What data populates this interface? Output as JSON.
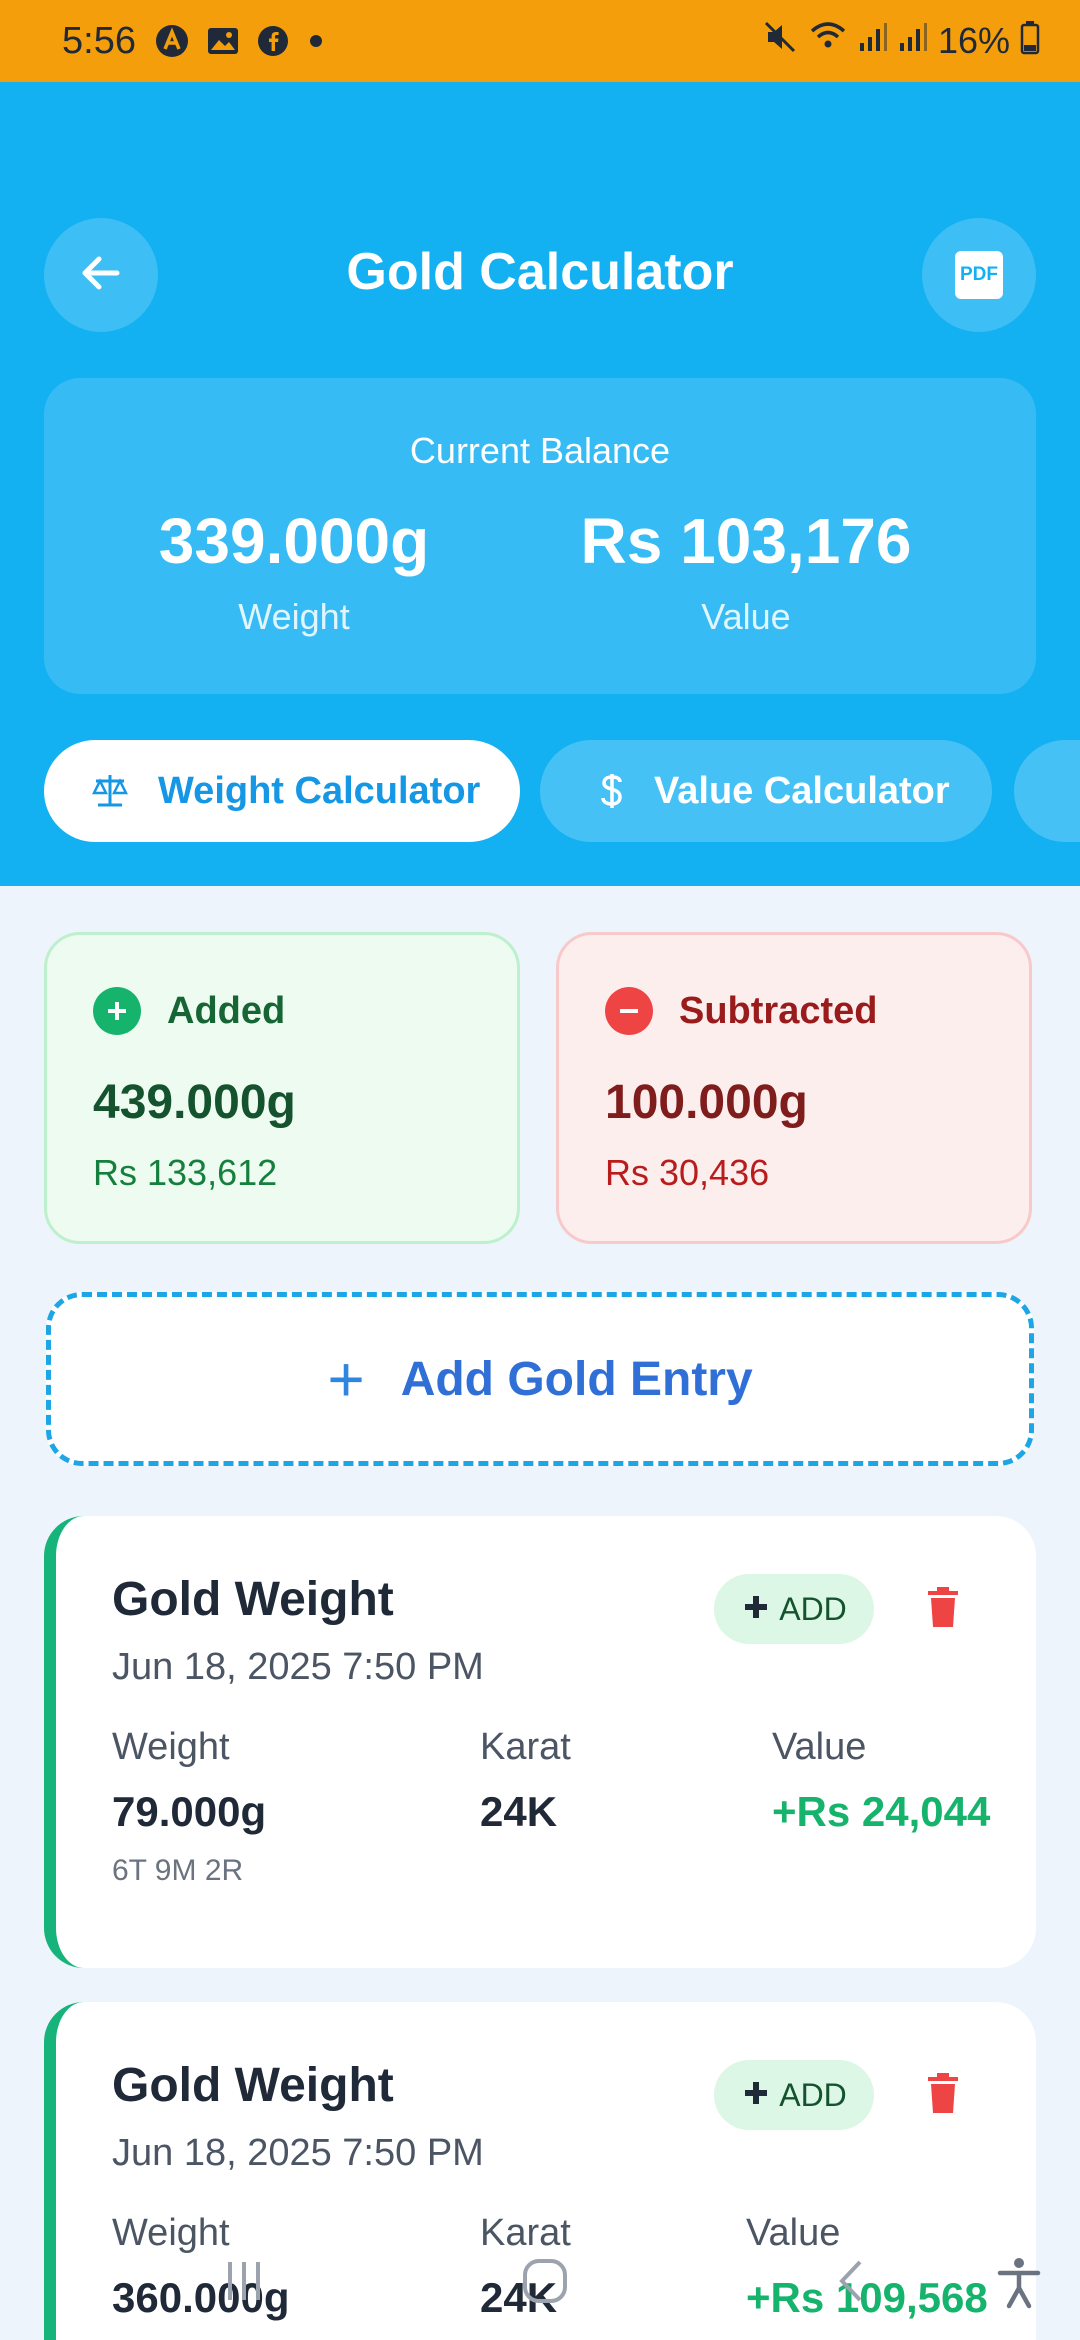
{
  "status_bar": {
    "time": "5:56",
    "battery": "16%",
    "icons_left": [
      "a-icon",
      "image-icon",
      "facebook-icon",
      "dot-icon"
    ],
    "icons_right": [
      "mute-icon",
      "wifi-icon",
      "signal-icon",
      "signal-icon",
      "battery-icon"
    ]
  },
  "header": {
    "title": "Gold Calculator",
    "pdf_label": "PDF",
    "balance": {
      "heading": "Current Balance",
      "weight_value": "339.000g",
      "weight_label": "Weight",
      "value_value": "Rs 103,176",
      "value_label": "Value"
    },
    "tabs": [
      {
        "label": "Weight Calculator",
        "icon": "scale-icon",
        "active": true
      },
      {
        "label": "Value Calculator",
        "icon": "dollar-icon",
        "active": false
      }
    ]
  },
  "summary": {
    "added": {
      "label": "Added",
      "weight": "439.000g",
      "value": "Rs 133,612"
    },
    "subtracted": {
      "label": "Subtracted",
      "weight": "100.000g",
      "value": "Rs 30,436"
    }
  },
  "add_entry": {
    "plus": "+",
    "label": "Add Gold Entry"
  },
  "entries": [
    {
      "title": "Gold Weight",
      "date": "Jun 18, 2025 7:50 PM",
      "badge": "ADD",
      "weight_label": "Weight",
      "weight": "79.000g",
      "weight_detail": "6T 9M 2R",
      "karat_label": "Karat",
      "karat": "24K",
      "value_label": "Value",
      "value": "+Rs 24,044"
    },
    {
      "title": "Gold Weight",
      "date": "Jun 18, 2025 7:50 PM",
      "badge": "ADD",
      "weight_label": "Weight",
      "weight": "360.000g",
      "karat_label": "Karat",
      "karat": "24K",
      "value_label": "Value",
      "value": "+Rs 109,568"
    }
  ],
  "colors": {
    "header_bg": "#13b0f2",
    "status_bg": "#f59e0b",
    "added_green": "#16b36d",
    "subtracted_red": "#ef4444",
    "accent_blue": "#2f6fd6"
  }
}
